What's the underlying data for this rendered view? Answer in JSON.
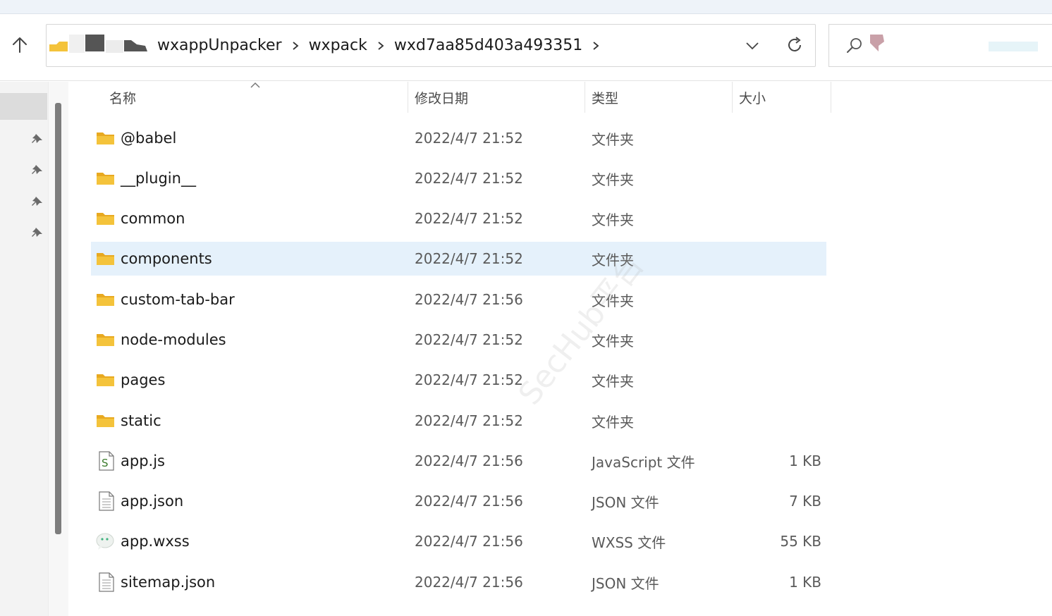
{
  "address_bar": {
    "breadcrumbs": [
      "wxappUnpacker",
      "wxpack",
      "wxd7aa85d403a493351"
    ]
  },
  "columns": {
    "name": "名称",
    "modified": "修改日期",
    "type": "类型",
    "size": "大小"
  },
  "files": [
    {
      "name": "@babel",
      "modified": "2022/4/7 21:52",
      "type": "文件夹",
      "size": "",
      "icon": "folder-icon"
    },
    {
      "name": "__plugin__",
      "modified": "2022/4/7 21:52",
      "type": "文件夹",
      "size": "",
      "icon": "folder-icon"
    },
    {
      "name": "common",
      "modified": "2022/4/7 21:52",
      "type": "文件夹",
      "size": "",
      "icon": "folder-icon"
    },
    {
      "name": "components",
      "modified": "2022/4/7 21:52",
      "type": "文件夹",
      "size": "",
      "icon": "folder-icon"
    },
    {
      "name": "custom-tab-bar",
      "modified": "2022/4/7 21:56",
      "type": "文件夹",
      "size": "",
      "icon": "folder-icon"
    },
    {
      "name": "node-modules",
      "modified": "2022/4/7 21:52",
      "type": "文件夹",
      "size": "",
      "icon": "folder-icon"
    },
    {
      "name": "pages",
      "modified": "2022/4/7 21:52",
      "type": "文件夹",
      "size": "",
      "icon": "folder-icon"
    },
    {
      "name": "static",
      "modified": "2022/4/7 21:52",
      "type": "文件夹",
      "size": "",
      "icon": "folder-icon"
    },
    {
      "name": "app.js",
      "modified": "2022/4/7 21:56",
      "type": "JavaScript 文件",
      "size": "1 KB",
      "icon": "javascript-file-icon"
    },
    {
      "name": "app.json",
      "modified": "2022/4/7 21:56",
      "type": "JSON 文件",
      "size": "7 KB",
      "icon": "text-file-icon"
    },
    {
      "name": "app.wxss",
      "modified": "2022/4/7 21:56",
      "type": "WXSS 文件",
      "size": "55 KB",
      "icon": "wechat-file-icon"
    },
    {
      "name": "sitemap.json",
      "modified": "2022/4/7 21:56",
      "type": "JSON 文件",
      "size": "1 KB",
      "icon": "text-file-icon"
    }
  ],
  "selected_row": "components",
  "watermark": "SecHub平台",
  "colors": {
    "folder": "#f4c33b",
    "selection": "#e5f1fb",
    "nav_pane": "#f3f3f3"
  }
}
